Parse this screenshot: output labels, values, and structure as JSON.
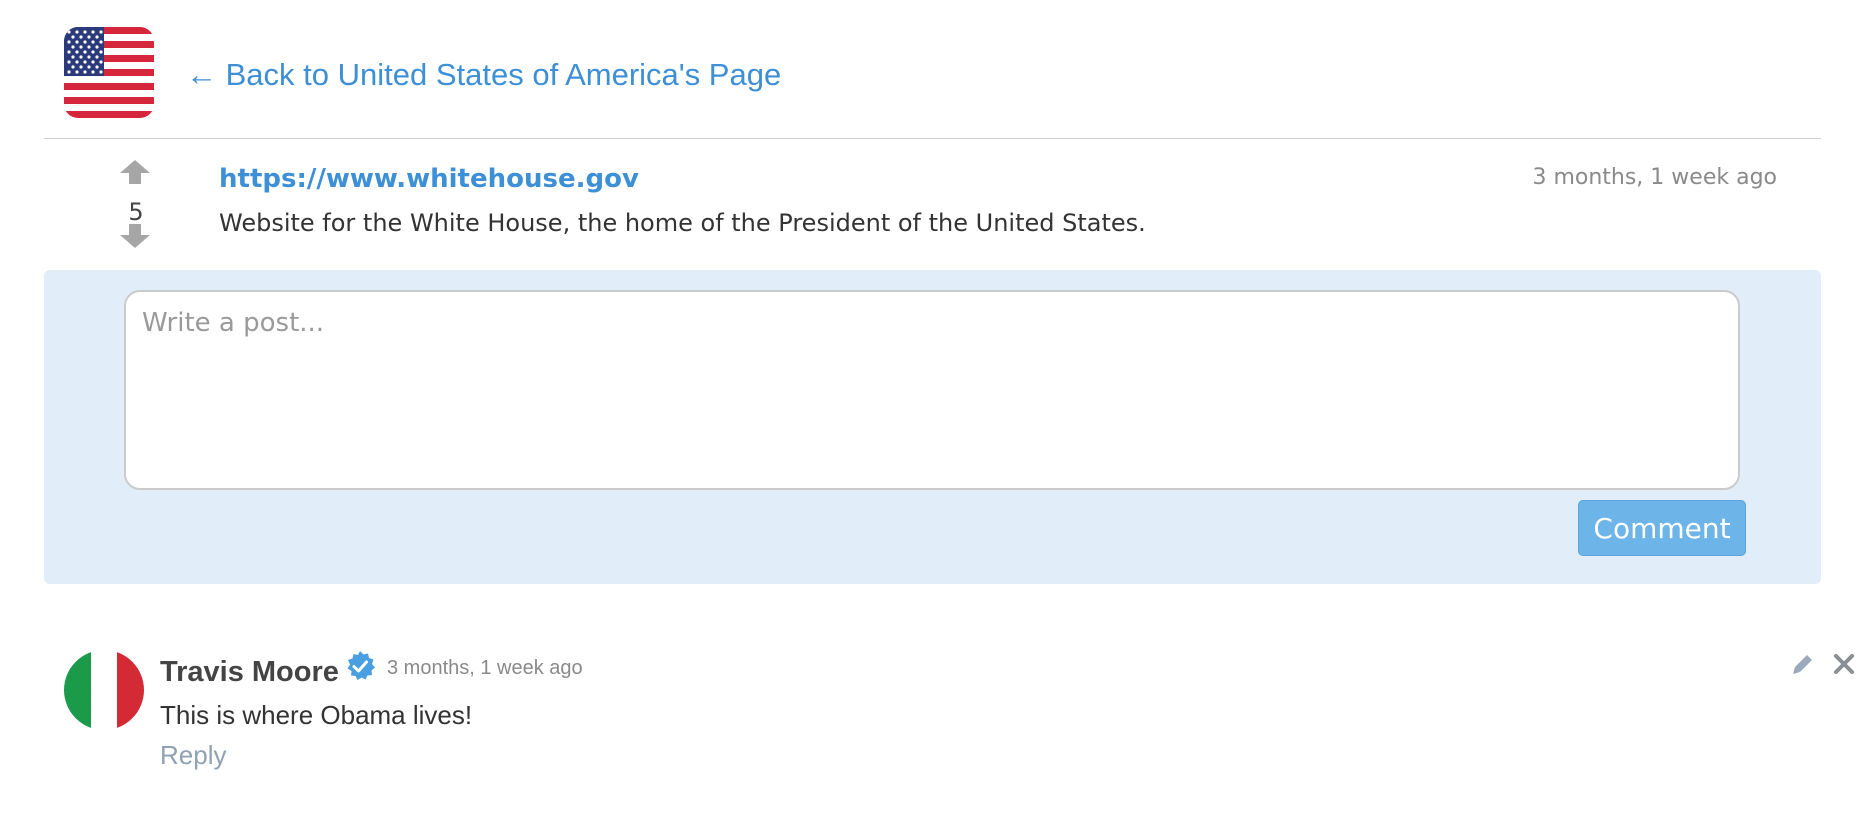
{
  "header": {
    "flag_icon": "us-flag-icon",
    "back_link": "← Back to United States of America's Page"
  },
  "post": {
    "votes": "5",
    "upvote_icon": "arrow-up-icon",
    "downvote_icon": "arrow-down-icon",
    "url": "https://www.whitehouse.gov",
    "timestamp": "3 months, 1 week ago",
    "description": "Website for the White House, the home of the President of the United States."
  },
  "composer": {
    "placeholder": "Write a post...",
    "value": "",
    "submit_label": "Comment"
  },
  "comments": [
    {
      "author": "Travis Moore",
      "avatar_icon": "italy-flag-avatar",
      "verified_icon": "verified-badge-icon",
      "timestamp": "3 months, 1 week ago",
      "text": "This is where Obama lives!",
      "reply_label": "Reply",
      "edit_icon": "pencil-icon",
      "delete_icon": "close-icon"
    }
  ],
  "colors": {
    "link": "#3d8fd6",
    "composer_bg": "#e1edf8",
    "button": "#6db4e8",
    "muted": "#8a8a8a"
  }
}
